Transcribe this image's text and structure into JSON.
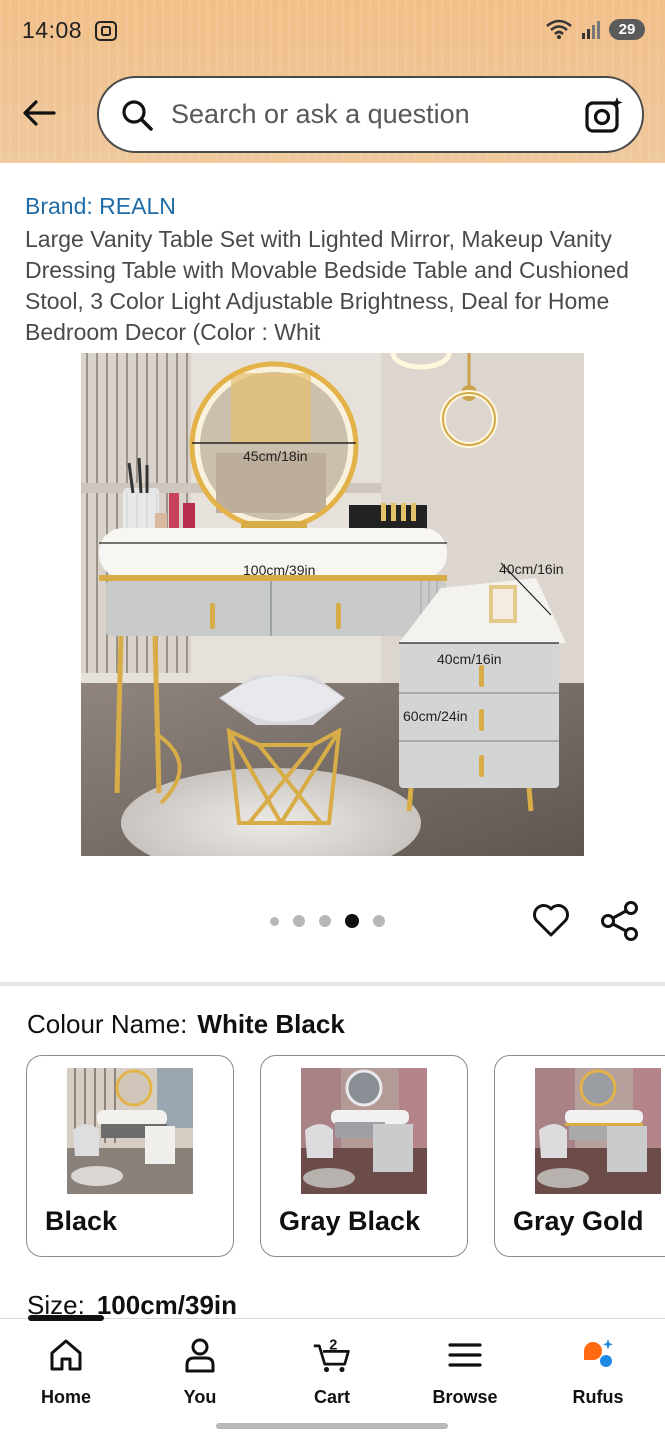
{
  "status_bar": {
    "time": "14:08",
    "battery": "29",
    "icons": [
      "screenshot-icon",
      "wifi-icon",
      "signal-icon",
      "battery-icon"
    ]
  },
  "header": {
    "search_placeholder": "Search or ask a question",
    "icons": [
      "back-arrow-icon",
      "search-icon",
      "camera-icon"
    ]
  },
  "product": {
    "brand": "Brand: REALN",
    "title": "Large Vanity Table Set with Lighted Mirror, Makeup Vanity Dressing Table with Movable Bedside Table and Cushioned Stool, 3 Color Light Adjustable Brightness, Deal for Home Bedroom Decor (Color : Whit",
    "image_labels": {
      "mirror": "45cm/18in",
      "table_width": "100cm/39in",
      "side_depth": "40cm/16in",
      "side_width": "40cm/16in",
      "side_height": "60cm/24in"
    },
    "carousel": {
      "count": 5,
      "active_index": 3
    }
  },
  "colour": {
    "label": "Colour Name:",
    "selected": "White Black",
    "options": [
      {
        "name": "Black"
      },
      {
        "name": "Gray Black"
      },
      {
        "name": "Gray Gold"
      }
    ]
  },
  "size": {
    "label": "Size:",
    "selected": "100cm/39in"
  },
  "bottom_nav": {
    "items": [
      {
        "label": "Home",
        "icon": "home-icon"
      },
      {
        "label": "You",
        "icon": "person-icon"
      },
      {
        "label": "Cart",
        "icon": "cart-icon",
        "badge": "2"
      },
      {
        "label": "Browse",
        "icon": "menu-icon"
      },
      {
        "label": "Rufus",
        "icon": "rufus-icon"
      }
    ]
  },
  "colors": {
    "header_band": "#f0c495",
    "brand_link": "#1f6ca8",
    "rufus_orange": "#ff6a13",
    "rufus_blue": "#1e88e5"
  }
}
